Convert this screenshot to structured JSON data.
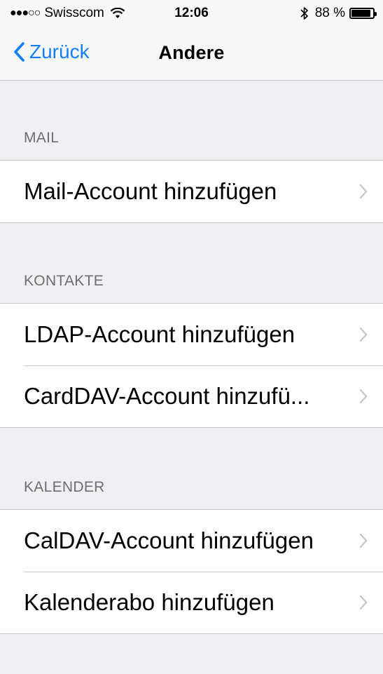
{
  "status_bar": {
    "signal": "●●●○○",
    "carrier": "Swisscom",
    "time": "12:06",
    "battery": "88 %",
    "battery_level": 0.88
  },
  "nav": {
    "back_label": "Zurück",
    "title": "Andere"
  },
  "sections": {
    "mail": {
      "header": "MAIL",
      "items": [
        "Mail-Account hinzufügen"
      ]
    },
    "contacts": {
      "header": "KONTAKTE",
      "items": [
        "LDAP-Account hinzufügen",
        "CardDAV-Account hinzufü..."
      ]
    },
    "calendar": {
      "header": "KALENDER",
      "items": [
        "CalDAV-Account hinzufügen",
        "Kalenderabo hinzufügen"
      ]
    }
  },
  "colors": {
    "accent": "#157efb",
    "background": "#efeff4",
    "separator": "#c8c7cc",
    "header_text": "#6d6d72",
    "chevron": "#c7c7cc"
  }
}
